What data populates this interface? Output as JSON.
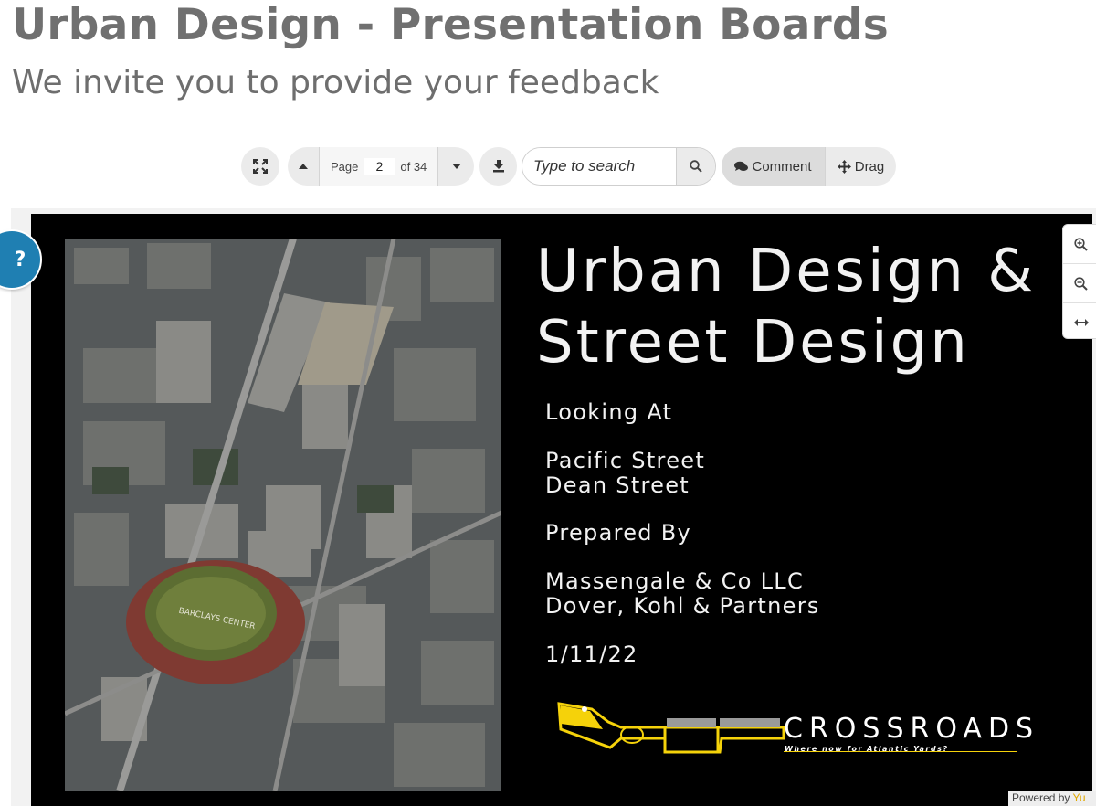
{
  "header": {
    "title": "Urban Design - Presentation Boards",
    "subtitle": "We invite you to provide your feedback"
  },
  "toolbar": {
    "page_label": "Page",
    "current_page": "2",
    "page_of": "of 34",
    "search_placeholder": "Type to search",
    "comment_label": "Comment",
    "drag_label": "Drag"
  },
  "slide": {
    "title_line1": "Urban Design &",
    "title_line2": "Street Design",
    "looking_at_heading": "Looking At",
    "street1": "Pacific Street",
    "street2": "Dean Street",
    "prepared_by_heading": "Prepared By",
    "firm1": "Massengale & Co LLC",
    "firm2": "Dover, Kohl & Partners",
    "date": "1/11/22",
    "logo_name": "CROSSROADS",
    "logo_tagline": "Where now for Atlantic Yards?",
    "photo_label": "BARCLAYS CENTER"
  },
  "help": {
    "label": "?"
  },
  "footer": {
    "powered_prefix": "Powered by",
    "powered_brand": "Yu"
  },
  "colors": {
    "accent_blue": "#1f7fb2",
    "logo_yellow": "#f5d20a",
    "toolbar_gray": "#ebebeb"
  },
  "icons": [
    "fullscreen-icon",
    "page-up-icon",
    "page-down-icon",
    "download-icon",
    "search-icon",
    "comment-icon",
    "drag-icon",
    "zoom-in-icon",
    "zoom-out-icon",
    "fit-width-icon"
  ]
}
